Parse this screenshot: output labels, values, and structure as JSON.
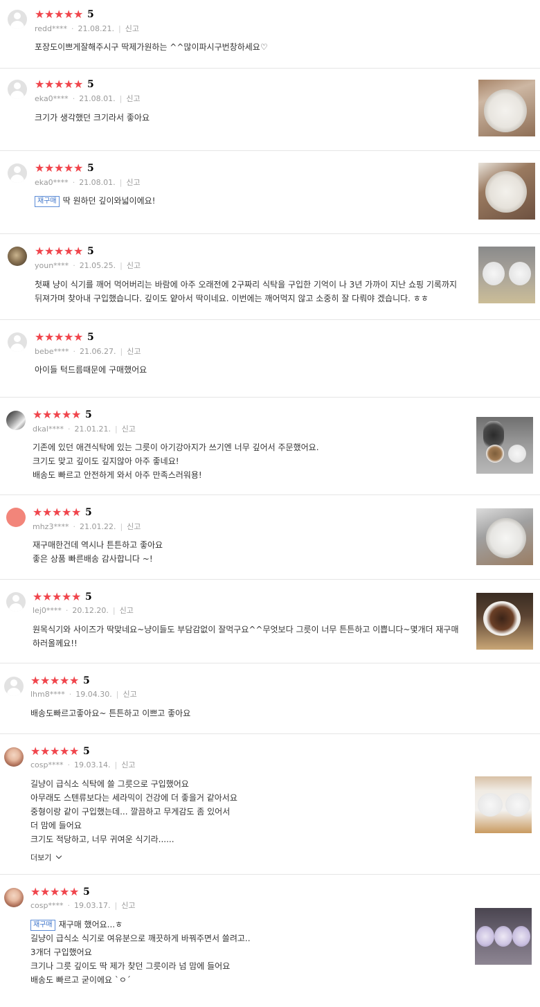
{
  "reviews": [
    {
      "user": "redd****",
      "date": "21.08.21.",
      "report": "신고",
      "score": "5",
      "avatar": "default",
      "lines": [
        "포장도이쁘게잘해주시구 딱제가원하는 ^^많이파시구번창하세요♡"
      ]
    },
    {
      "user": "eka0****",
      "date": "21.08.01.",
      "report": "신고",
      "score": "5",
      "avatar": "default",
      "lines": [
        "크기가 생각했던 크기라서 좋아요"
      ]
    },
    {
      "user": "eka0****",
      "date": "21.08.01.",
      "report": "신고",
      "score": "5",
      "avatar": "default",
      "badge": "재구매",
      "lines": [
        "딱 원하던 깊이와넓이에요!"
      ]
    },
    {
      "user": "youn****",
      "date": "21.05.25.",
      "report": "신고",
      "score": "5",
      "avatar": "cat",
      "lines": [
        "첫째 냥이 식기를 깨어 먹어버리는 바람에 아주 오래전에 2구짜리 식탁을 구입한 기억이 나 3년 가까이 지난 쇼핑 기록까지",
        "뒤져가며 찾아내 구입했습니다. 깊이도 얕아서 딱이네요.  이번에는 깨어먹지 않고 소중히 잘 다뤄야 겠습니다. ㅎㅎ"
      ]
    },
    {
      "user": "bebe****",
      "date": "21.06.27.",
      "report": "신고",
      "score": "5",
      "avatar": "default",
      "lines": [
        "아이들 턱드름때문에 구매했어요"
      ]
    },
    {
      "user": "dkal****",
      "date": "21.01.21.",
      "report": "신고",
      "score": "5",
      "avatar": "bw",
      "lines": [
        "기존에 있던 애견식탁에 있는 그릇이 아기강아지가 쓰기엔 너무 깊어서 주문했어요.",
        "크기도 맞고 깊이도 깊지않아 아주 좋네요!",
        "배송도 빠르고 안전하게 와서 아주 만족스러워용!"
      ]
    },
    {
      "user": "mhz3****",
      "date": "21.01.22.",
      "report": "신고",
      "score": "5",
      "avatar": "salmon",
      "lines": [
        "재구매한건데 역시나 튼튼하고 좋아요",
        "좋은 상품 빠른배송 감사합니다 ~!"
      ]
    },
    {
      "user": "lej0****",
      "date": "20.12.20.",
      "report": "신고",
      "score": "5",
      "avatar": "default",
      "lines": [
        "원목식기와 사이즈가 딱맞네요~냥이들도 부담감없이 잘먹구요^^무엇보다 그릇이 너무 튼튼하고 이쁩니다~몇개더 재구매",
        "하러올께요!!"
      ]
    },
    {
      "user": "lhm8****",
      "date": "19.04.30.",
      "report": "신고",
      "score": "5",
      "avatar": "default",
      "lines": [
        "배송도빠르고좋아요~ 튼튼하고 이쁘고 좋아요"
      ]
    },
    {
      "user": "cosp****",
      "date": "19.03.14.",
      "report": "신고",
      "score": "5",
      "avatar": "person",
      "more": "더보기",
      "lines": [
        "길냥이 급식소 식탁에 쓸 그릇으로 구입했어요",
        "아무래도 스텐류보다는 세라믹이 건강에 더 좋을거 같아서요",
        "중형이랑 같이 구입했는데... 깔끔하고 무게감도 좀 있어서",
        "더 맘에 들어요",
        "크기도 적당하고, 너무 귀여운 식기라......"
      ]
    },
    {
      "user": "cosp****",
      "date": "19.03.17.",
      "report": "신고",
      "score": "5",
      "avatar": "person",
      "badge": "재구매",
      "lines": [
        "재구매 했어요...ㅎ",
        "길냥이 급식소 식기로 여유분으로 깨끗하게 바꿔주면서 쓸려고..",
        "3개더 구입했어요",
        "크기나 그릇 깊이도 딱 제가 찾던 그릇이라 넘 맘에 들어요",
        "배송도 빠르고 굳이에요 ˋㅇˊ"
      ]
    }
  ]
}
